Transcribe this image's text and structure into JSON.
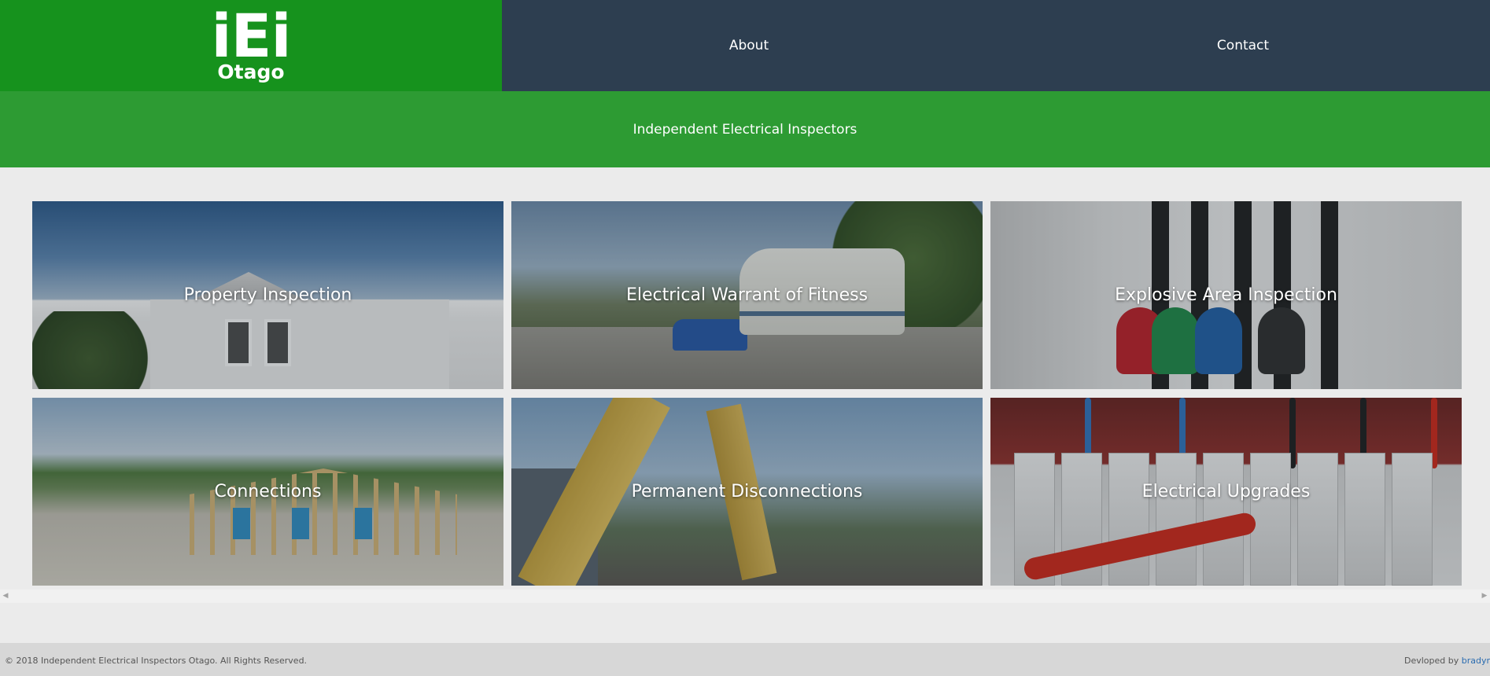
{
  "header": {
    "logo_main": "iEi",
    "logo_sub": "Otago",
    "nav": [
      {
        "label": "About"
      },
      {
        "label": "Contact"
      }
    ]
  },
  "tagline": "Independent Electrical Inspectors",
  "services": [
    {
      "label": "Property Inspection"
    },
    {
      "label": "Electrical Warrant of Fitness"
    },
    {
      "label": "Explosive Area Inspection"
    },
    {
      "label": "Connections"
    },
    {
      "label": "Permanent Disconnections"
    },
    {
      "label": "Electrical Upgrades"
    }
  ],
  "footer": {
    "copyright": "© 2018 Independent Electrical Inspectors Otago. All Rights Reserved.",
    "developed_prefix": "Devloped by ",
    "developer": "bradyr"
  },
  "colors": {
    "logo_green": "#16921d",
    "nav_navy": "#2d3e50",
    "tagline_green": "#2d9b33",
    "page_bg": "#ebebeb",
    "footer_bg": "#d7d7d7",
    "link_blue": "#2b6cb0"
  }
}
